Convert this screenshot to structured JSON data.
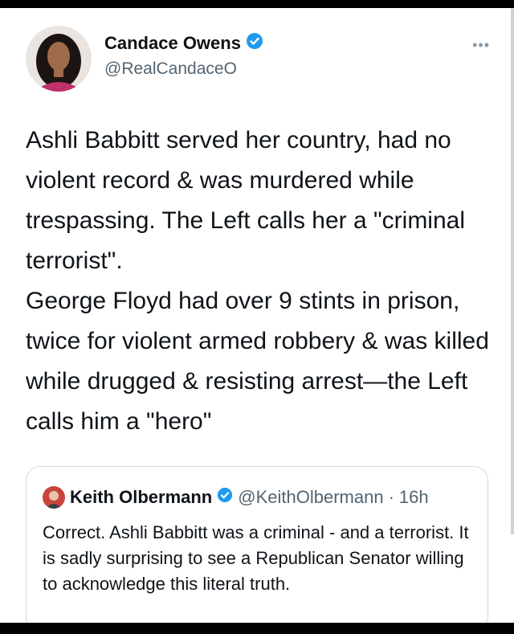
{
  "tweet": {
    "author_name": "Candace Owens",
    "author_handle": "@RealCandaceO",
    "more_label": "•••",
    "text_para1": "Ashli Babbitt served her country, had no violent record & was murdered while trespassing. The Left calls her a \"criminal terrorist\".",
    "text_para2": "George Floyd had over 9 stints in prison, twice for violent armed robbery & was killed while drugged & resisting arrest—the Left calls him a \"hero\""
  },
  "quoted_tweet": {
    "author_name": "Keith Olbermann",
    "author_handle": "@KeithOlbermann",
    "separator": "·",
    "time": "16h",
    "text": "Correct. Ashli Babbitt was a criminal - and a terrorist. It is sadly surprising to see a Republican Senator willing to acknowledge this literal truth."
  },
  "colors": {
    "verified": "#1d9bf0",
    "text": "#0f1419",
    "muted": "#536471",
    "border": "#cfd9de"
  }
}
